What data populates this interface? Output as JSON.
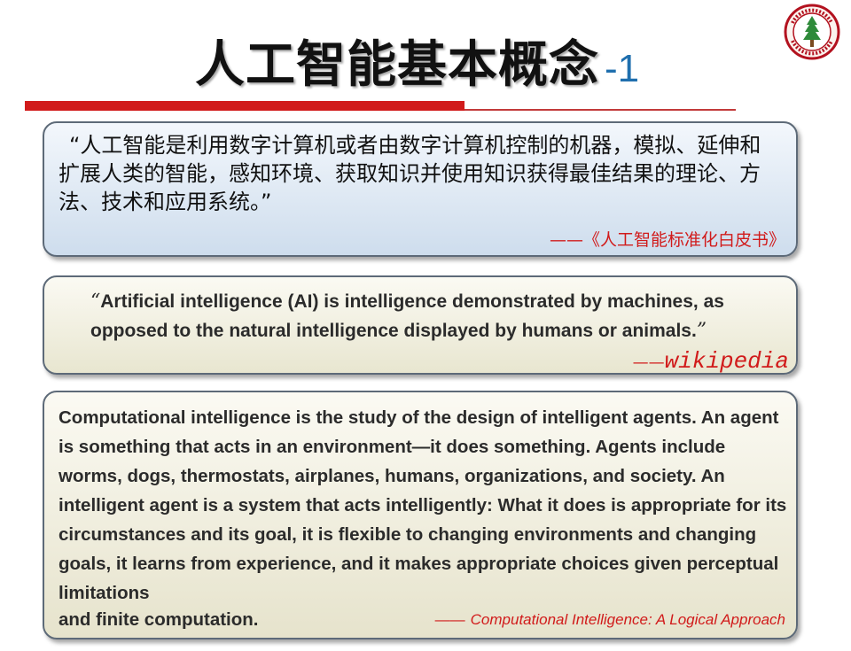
{
  "slide": {
    "title": "人工智能基本概念",
    "title_number": "-1",
    "colors": {
      "title_number": "#1f6fae",
      "accent_red": "#d11b1b",
      "box1_fill": "#cedded",
      "box2_fill": "#e8e6d0"
    }
  },
  "logo": {
    "icon": "university-seal-icon"
  },
  "definition_cn": {
    "text": "“人工智能是利用数字计算机或者由数字计算机控制的机器，模拟、延伸和扩展人类的智能，感知环境、获取知识并使用知识获得最佳结果的理论、方法、技术和应用系统。”",
    "source": "——《人工智能标准化白皮书》"
  },
  "definition_wiki": {
    "open_quote": "“",
    "text": "Artificial intelligence (AI) is intelligence demonstrated by machines, as opposed to the natural intelligence displayed by humans or animals.",
    "close_quote": "”",
    "source_dash": "——",
    "source_name": "wikipedia"
  },
  "definition_ci": {
    "text": "Computational intelligence is the study of the design of intelligent agents. An agent is something that acts in an environment—it does something. Agents include worms, dogs, thermostats, airplanes, humans, organizations, and society. An intelligent agent is a system that acts intelligently: What it does is appropriate for its circumstances and its goal, it is flexible to changing environments and changing goals, it learns from experience, and it makes appropriate choices given perceptual limitations",
    "last_line": "and finite computation.",
    "source_dash": "——",
    "source_name": "Computational Intelligence: A Logical Approach"
  }
}
